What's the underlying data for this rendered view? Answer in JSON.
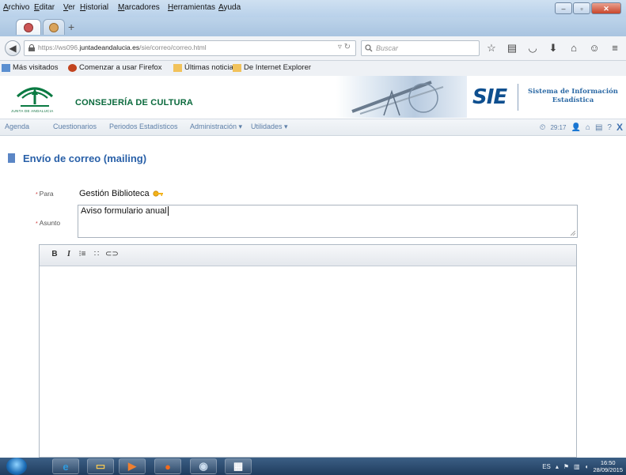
{
  "browser": {
    "menu": [
      "Archivo",
      "Editar",
      "Ver",
      "Historial",
      "Marcadores",
      "Herramientas",
      "Ayuda"
    ],
    "url": {
      "prefix": "https://ws096.",
      "domain": "juntadeandalucia.es",
      "path": "/sie/correo/correo.html"
    },
    "search_placeholder": "Buscar",
    "bookmarks": [
      "Más visitados",
      "Comenzar a usar Firefox",
      "Últimas noticias",
      "De Internet Explorer"
    ]
  },
  "header": {
    "junta_text": "JUNTA DE ANDALUCIA",
    "consejeria": "CONSEJERÍA DE CULTURA",
    "sie_logo": "SIE",
    "sie_subtitle_1": "Sistema de Información",
    "sie_subtitle_2": "Estadística"
  },
  "app_menu": {
    "items": [
      "Agenda",
      "Cuestionarios",
      "Periodos Estadísticos",
      "Administración ▾",
      "Utilidades ▾"
    ],
    "timer": "29:17",
    "help": "?",
    "close": "X"
  },
  "page": {
    "title": "Envío de correo (mailing)",
    "para_label": "Para",
    "para_value": "Gestión Biblioteca",
    "asunto_label": "Asunto",
    "asunto_value": "Aviso formulario anual"
  },
  "editor": {
    "toolbar": [
      "B",
      "I",
      "ordered-list-icon",
      "unordered-list-icon",
      "link-icon"
    ]
  },
  "taskbar": {
    "language": "ES",
    "time": "16:50",
    "date": "28/09/2015"
  },
  "colors": {
    "accent": "#2960a8",
    "menu_link": "#5d7fa8",
    "junta_green": "#0b6a3d",
    "sie_blue": "#0e4f8f"
  }
}
